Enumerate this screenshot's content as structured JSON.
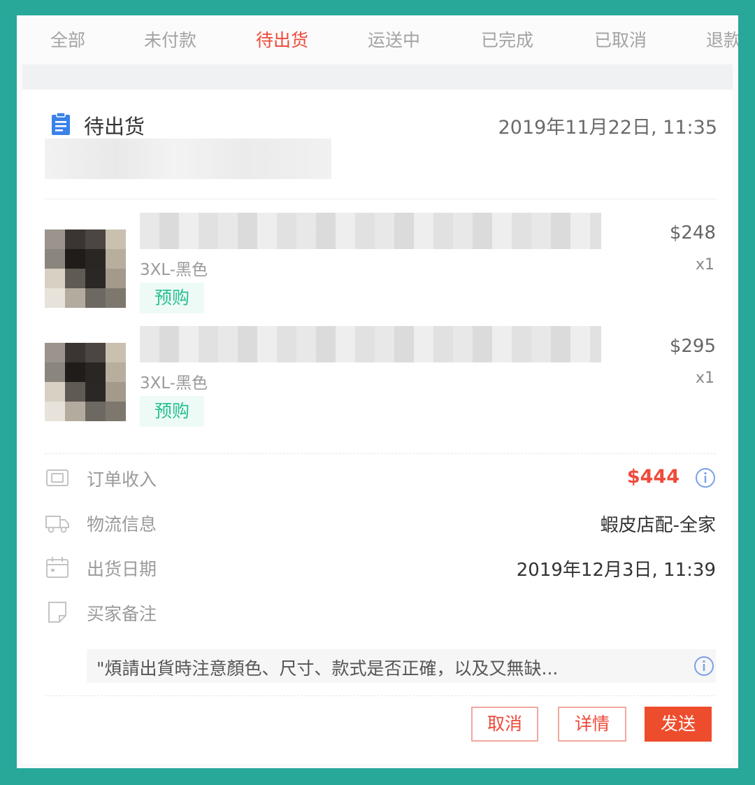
{
  "tabs": [
    {
      "label": "全部",
      "active": false
    },
    {
      "label": "未付款",
      "active": false
    },
    {
      "label": "待出货",
      "active": true
    },
    {
      "label": "运送中",
      "active": false
    },
    {
      "label": "已完成",
      "active": false
    },
    {
      "label": "已取消",
      "active": false
    },
    {
      "label": "退款",
      "active": false
    }
  ],
  "order": {
    "status_icon": "clipboard-icon",
    "status": "待出货",
    "timestamp": "2019年11月22日, 11:35",
    "items": [
      {
        "variant": "3XL-黑色",
        "badge": "预购",
        "price": "$248",
        "qty": "x1"
      },
      {
        "variant": "3XL-黑色",
        "badge": "预购",
        "price": "$295",
        "qty": "x1"
      }
    ],
    "info": {
      "income": {
        "icon": "wallet-icon",
        "label": "订单收入",
        "value": "$444"
      },
      "logistics": {
        "icon": "truck-icon",
        "label": "物流信息",
        "value": "蝦皮店配-全家"
      },
      "ship_date": {
        "icon": "calendar-icon",
        "label": "出货日期",
        "value": "2019年12月3日, 11:39"
      },
      "buyer_note": {
        "icon": "note-icon",
        "label": "买家备注",
        "value": "\"煩請出貨時注意顏色、尺寸、款式是否正確，以及又無缺..."
      }
    },
    "actions": {
      "cancel": "取消",
      "details": "详情",
      "ship": "发送"
    }
  },
  "colors": {
    "accent": "#ee4d2d",
    "frame": "#27a899",
    "badge": "#27bf93"
  }
}
